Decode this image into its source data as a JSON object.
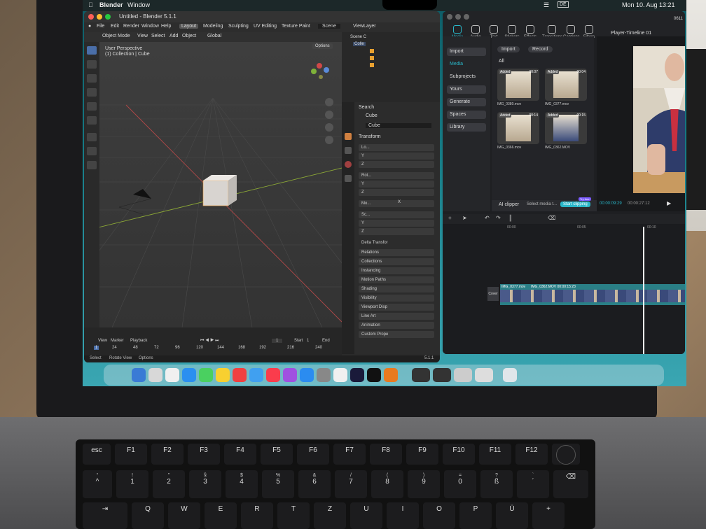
{
  "menubar": {
    "app": "Blender",
    "window_menu": "Window",
    "status_items": [
      "DE"
    ],
    "datetime": "Mon 10. Aug  13:21"
  },
  "blender": {
    "title": "Untitled - Blender 5.1.1",
    "menus": [
      "File",
      "Edit",
      "Render",
      "Window",
      "Help"
    ],
    "workspaces": [
      "Layout",
      "Modeling",
      "Sculpting",
      "UV Editing",
      "Texture Paint"
    ],
    "scene_label": "Scene",
    "view_layer_label": "ViewLayer",
    "toolbar": {
      "mode": "Object Mode",
      "view": "View",
      "select": "Select",
      "add": "Add",
      "object": "Object",
      "orientation": "Global",
      "options": "Options"
    },
    "viewport": {
      "perspective": "User Perspective",
      "collection": "(1) Collection | Cube"
    },
    "outliner": {
      "scene_collection": "Scene C",
      "collection": "Colle"
    },
    "search": "Search",
    "properties": {
      "object_name": "Cube",
      "object_field": "Cube",
      "transform": "Transform",
      "rows": [
        "Lo...",
        "Y",
        "Z",
        "Rot...",
        "Y",
        "Z",
        "Mo...",
        "Sc...",
        "Y",
        "Z"
      ],
      "mode_value": "X",
      "sections": [
        "Delta Transfor",
        "Relations",
        "Collections",
        "Instancing",
        "Motion Paths",
        "Shading",
        "Visibility",
        "Viewport Disp",
        "Line Art",
        "Animation",
        "Custom Prope"
      ]
    },
    "timeline": {
      "view": "View",
      "marker": "Marker",
      "playback": "Playback",
      "frame": "1",
      "start_label": "Start",
      "start": "1",
      "end_label": "End",
      "ticks": [
        "1",
        "24",
        "48",
        "72",
        "96",
        "120",
        "144",
        "168",
        "192",
        "216",
        "240"
      ]
    },
    "status": {
      "select": "Select",
      "rotate": "Rotate View",
      "options": "Options",
      "version": "5.1.1"
    }
  },
  "editor": {
    "tabs": [
      "Media",
      "Audio",
      "Text",
      "Stickers",
      "Effects",
      "Transitions",
      "Captions",
      "Filters"
    ],
    "player_title": "Player-Timeline 01",
    "project_name": "0611",
    "sidebar": [
      "Import",
      "Media",
      "Subprojects",
      "Yours",
      "Generate",
      "Spaces",
      "Library"
    ],
    "import_button": "Import",
    "record_button": "Record",
    "all_label": "All",
    "clips": [
      {
        "badge": "Added",
        "duration": "00:07",
        "name": "IMG_0380.mov"
      },
      {
        "badge": "Added",
        "duration": "00:04",
        "name": "IMG_0377.mov"
      },
      {
        "badge": "Added",
        "duration": "00:14",
        "name": "IMG_0366.mov"
      },
      {
        "badge": "Added",
        "duration": "00:15",
        "name": "IMG_0362.MOV"
      }
    ],
    "ai_clipper": "AI clipper",
    "select_media": "Select media t...",
    "start_clipping": "Start clipping",
    "try_free": "Try free",
    "time_current": "00:00:09:29",
    "time_total": "00:00:27:12",
    "ruler": [
      "00:00",
      "00:05",
      "00:10"
    ],
    "track_label": "Cover",
    "track_clips": [
      "IMG_0377.mov",
      "IMG_0362.MOV  00:00:15:23"
    ]
  },
  "keyboard": {
    "esc": "esc",
    "fkeys": [
      "F1",
      "F2",
      "F3",
      "F4",
      "F5",
      "F6",
      "F7",
      "F8",
      "F9",
      "F10",
      "F11",
      "F12"
    ],
    "num_row_top": [
      "°",
      "!",
      "\"",
      "§",
      "$",
      "%",
      "&",
      "/",
      "(",
      ")",
      "=",
      "?",
      "`"
    ],
    "num_row": [
      "^",
      "1",
      "2",
      "3",
      "4",
      "5",
      "6",
      "7",
      "8",
      "9",
      "0",
      "ß",
      "´"
    ],
    "letters": [
      "Q",
      "W",
      "E",
      "R",
      "T",
      "Z",
      "U",
      "I",
      "O",
      "P",
      "Ü",
      "+"
    ]
  },
  "colors": {
    "accent_teal": "#2a7f86",
    "start_clipping": "#29b6c8",
    "ai_clipper": "#4a7dff"
  }
}
